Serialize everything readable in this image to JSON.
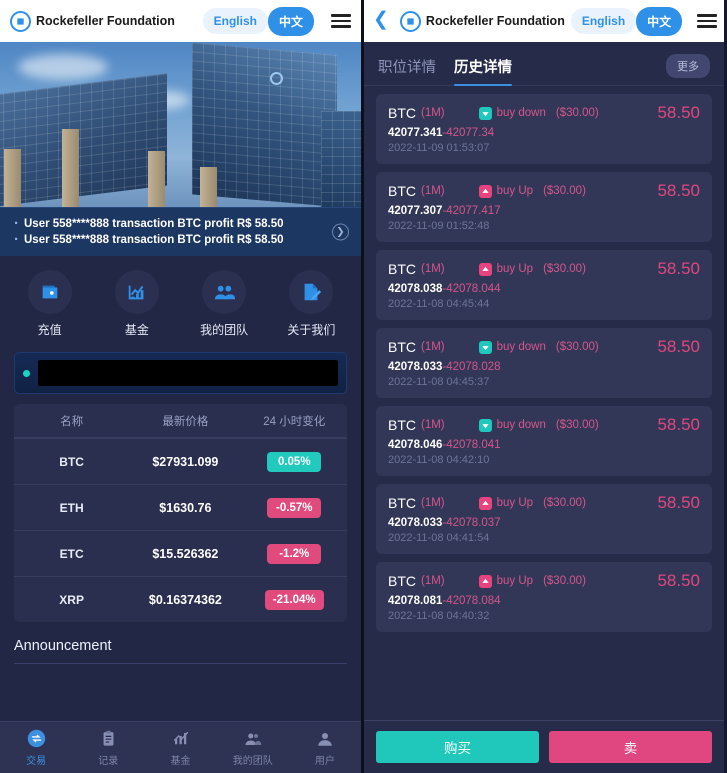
{
  "left": {
    "header": {
      "brand": "Rockefeller Foundation",
      "lang_en": "English",
      "lang_zh": "中文",
      "logo_icon": "diamond-ring-logo",
      "menu_icon": "hamburger-menu-icon"
    },
    "hero": {
      "alt": "office-buildings-photo"
    },
    "notices": [
      "User 558****888 transaction BTC profit R$ 58.50",
      "User 558****888 transaction BTC profit R$ 58.50"
    ],
    "notice_arrow_icon": "chevron-right-circle-icon",
    "quick_actions": [
      {
        "label": "充值",
        "icon": "wallet-icon"
      },
      {
        "label": "基金",
        "icon": "chart-line-icon"
      },
      {
        "label": "我的团队",
        "icon": "people-group-icon"
      },
      {
        "label": "关于我们",
        "icon": "document-pencil-icon"
      }
    ],
    "ticker": {
      "indicator": "status-dot",
      "screen_text": ""
    },
    "table": {
      "headers": [
        "名称",
        "最新价格",
        "24 小时变化"
      ],
      "rows": [
        {
          "symbol": "BTC",
          "price": "$27931.099",
          "change": "0.05%",
          "dir": "up"
        },
        {
          "symbol": "ETH",
          "price": "$1630.76",
          "change": "-0.57%",
          "dir": "down"
        },
        {
          "symbol": "ETC",
          "price": "$15.526362",
          "change": "-1.2%",
          "dir": "down"
        },
        {
          "symbol": "XRP",
          "price": "$0.16374362",
          "change": "-21.04%",
          "dir": "down"
        }
      ]
    },
    "announcement": {
      "title": "Announcement"
    },
    "bottom_nav": [
      {
        "label": "交易",
        "icon": "exchange-icon",
        "active": true
      },
      {
        "label": "记录",
        "icon": "clipboard-icon",
        "active": false
      },
      {
        "label": "基金",
        "icon": "bar-chart-icon",
        "active": false
      },
      {
        "label": "我的团队",
        "icon": "people-icon",
        "active": false
      },
      {
        "label": "用户",
        "icon": "user-icon",
        "active": false
      }
    ]
  },
  "right": {
    "header": {
      "back_icon": "chevron-left-icon",
      "brand": "Rockefeller Foundation",
      "lang_en": "English",
      "lang_zh": "中文",
      "menu_icon": "hamburger-menu-icon"
    },
    "tabs": [
      {
        "label": "职位详情",
        "active": false
      },
      {
        "label": "历史详情",
        "active": true
      }
    ],
    "more_label": "更多",
    "records": [
      {
        "symbol": "BTC",
        "period": "(1M)",
        "direction": "buy down",
        "dir": "down",
        "amount": "($30.00)",
        "profit": "58.50",
        "open": "42077.341",
        "close": "42077.34",
        "time": "2022-11-09 01:53:07"
      },
      {
        "symbol": "BTC",
        "period": "(1M)",
        "direction": "buy Up",
        "dir": "up",
        "amount": "($30.00)",
        "profit": "58.50",
        "open": "42077.307",
        "close": "42077.417",
        "time": "2022-11-09 01:52:48"
      },
      {
        "symbol": "BTC",
        "period": "(1M)",
        "direction": "buy Up",
        "dir": "up",
        "amount": "($30.00)",
        "profit": "58.50",
        "open": "42078.038",
        "close": "42078.044",
        "time": "2022-11-08 04:45:44"
      },
      {
        "symbol": "BTC",
        "period": "(1M)",
        "direction": "buy down",
        "dir": "down",
        "amount": "($30.00)",
        "profit": "58.50",
        "open": "42078.033",
        "close": "42078.028",
        "time": "2022-11-08 04:45:37"
      },
      {
        "symbol": "BTC",
        "period": "(1M)",
        "direction": "buy down",
        "dir": "down",
        "amount": "($30.00)",
        "profit": "58.50",
        "open": "42078.046",
        "close": "42078.041",
        "time": "2022-11-08 04:42:10"
      },
      {
        "symbol": "BTC",
        "period": "(1M)",
        "direction": "buy Up",
        "dir": "up",
        "amount": "($30.00)",
        "profit": "58.50",
        "open": "42078.033",
        "close": "42078.037",
        "time": "2022-11-08 04:41:54"
      },
      {
        "symbol": "BTC",
        "period": "(1M)",
        "direction": "buy Up",
        "dir": "up",
        "amount": "($30.00)",
        "profit": "58.50",
        "open": "42078.081",
        "close": "42078.084",
        "time": "2022-11-08 04:40:32"
      }
    ],
    "actions": {
      "buy_label": "购买",
      "sell_label": "卖"
    }
  },
  "colors": {
    "accent_blue": "#2f90e8",
    "teal": "#1fc8bb",
    "pink": "#e0467f",
    "panel_bg": "#262b4a",
    "card_bg": "#323757"
  }
}
